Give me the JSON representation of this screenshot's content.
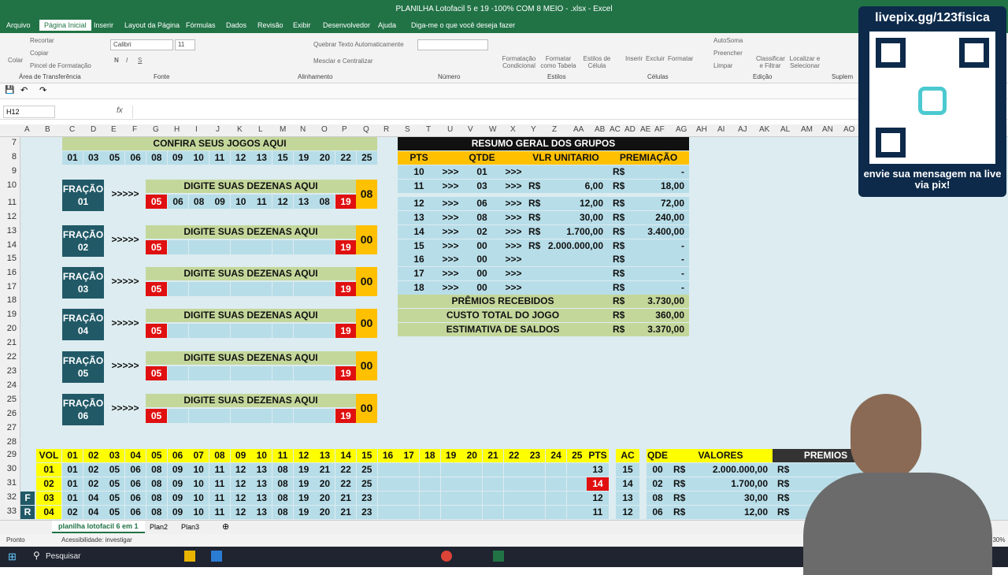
{
  "window": {
    "title": "PLANILHA Lotofacil 5 e 19 -100% COM 8 MEIO - .xlsx  -  Excel"
  },
  "tabs": [
    "Arquivo",
    "Página Inicial",
    "Inserir",
    "Layout da Página",
    "Fórmulas",
    "Dados",
    "Revisão",
    "Exibir",
    "Desenvolvedor",
    "Ajuda",
    "Diga-me o que você deseja fazer"
  ],
  "ribbon": {
    "clipboard": "Área de Transferência",
    "recortar": "Recortar",
    "copiar": "Copiar",
    "pincel": "Pincel de Formatação",
    "colar": "Colar",
    "font_name": "Calibri",
    "font_size": "11",
    "fonte": "Fonte",
    "quebrar": "Quebrar Texto Automaticamente",
    "mesclar": "Mesclar e Centralizar",
    "alinhamento": "Alinhamento",
    "numero": "Número",
    "estilos": "Estilos",
    "cond": "Formatação Condicional",
    "tabela": "Formatar como Tabela",
    "estcel": "Estilos de Célula",
    "inserir": "Inserir",
    "excluir": "Excluir",
    "formatar": "Formatar",
    "celulas": "Células",
    "autosoma": "AutoSoma",
    "preencher": "Preencher",
    "limpar": "Limpar",
    "classificar": "Classificar e Filtrar",
    "localizar": "Localizar e Selecionar",
    "edicao": "Edição",
    "suplem": "Suplem"
  },
  "namebox": "H12",
  "fx": "fx",
  "columns": [
    "A",
    "B",
    "C",
    "D",
    "E",
    "F",
    "G",
    "H",
    "I",
    "J",
    "K",
    "L",
    "M",
    "N",
    "O",
    "P",
    "Q",
    "R",
    "S",
    "T",
    "U",
    "V",
    "W",
    "X",
    "Y",
    "Z",
    "AA",
    "AB",
    "AC",
    "AD",
    "AE",
    "AF",
    "AG",
    "AH",
    "AI",
    "AJ",
    "AK",
    "AL",
    "AM",
    "AN",
    "AO"
  ],
  "rows": [
    "7",
    "8",
    "9",
    "10",
    "11",
    "12",
    "13",
    "14",
    "15",
    "16",
    "17",
    "18",
    "19",
    "20",
    "21",
    "22",
    "23",
    "24",
    "25",
    "26",
    "27",
    "28",
    "29",
    "30",
    "31",
    "32",
    "33"
  ],
  "confira": "CONFIRA SEUS JOGOS AQUI",
  "confira_nums": [
    "01",
    "03",
    "05",
    "06",
    "08",
    "09",
    "10",
    "11",
    "12",
    "13",
    "15",
    "19",
    "20",
    "22",
    "25"
  ],
  "fracoes": [
    {
      "label": "FRAÇÃO",
      "num": "01",
      "arrow": ">>>>>",
      "header": "DIGITE SUAS DEZENAS AQUI",
      "first": "05",
      "mid": [
        "06",
        "08",
        "09",
        "10",
        "11",
        "12",
        "13",
        "08"
      ],
      "last": "19",
      "score": "08"
    },
    {
      "label": "FRAÇÃO",
      "num": "02",
      "arrow": ">>>>>",
      "header": "DIGITE SUAS DEZENAS AQUI",
      "first": "05",
      "mid": [],
      "last": "19",
      "score": "00"
    },
    {
      "label": "FRAÇÃO",
      "num": "03",
      "arrow": ">>>>>",
      "header": "DIGITE SUAS DEZENAS AQUI",
      "first": "05",
      "mid": [],
      "last": "19",
      "score": "00"
    },
    {
      "label": "FRAÇÃO",
      "num": "04",
      "arrow": ">>>>>",
      "header": "DIGITE SUAS DEZENAS AQUI",
      "first": "05",
      "mid": [],
      "last": "19",
      "score": "00"
    },
    {
      "label": "FRAÇÃO",
      "num": "05",
      "arrow": ">>>>>",
      "header": "DIGITE SUAS DEZENAS AQUI",
      "first": "05",
      "mid": [],
      "last": "19",
      "score": "00"
    },
    {
      "label": "FRAÇÃO",
      "num": "06",
      "arrow": ">>>>>",
      "header": "DIGITE SUAS DEZENAS AQUI",
      "first": "05",
      "mid": [],
      "last": "19",
      "score": "00"
    }
  ],
  "resumo": {
    "title": "RESUMO GERAL DOS GRUPOS",
    "h_pts": "PTS",
    "h_qtde": "QTDE",
    "h_vlr": "VLR UNITARIO",
    "h_prem": "PREMIAÇÃO",
    "rows": [
      [
        "10",
        ">>>",
        "01",
        ">>>",
        "",
        "",
        "R$",
        "-"
      ],
      [
        "11",
        ">>>",
        "03",
        ">>>",
        "R$",
        "6,00",
        "R$",
        "18,00"
      ],
      [
        "12",
        ">>>",
        "06",
        ">>>",
        "R$",
        "12,00",
        "R$",
        "72,00"
      ],
      [
        "13",
        ">>>",
        "08",
        ">>>",
        "R$",
        "30,00",
        "R$",
        "240,00"
      ],
      [
        "14",
        ">>>",
        "02",
        ">>>",
        "R$",
        "1.700,00",
        "R$",
        "3.400,00"
      ],
      [
        "15",
        ">>>",
        "00",
        ">>>",
        "R$",
        "2.000.000,00",
        "R$",
        "-"
      ],
      [
        "16",
        ">>>",
        "00",
        ">>>",
        "",
        "",
        "R$",
        "-"
      ],
      [
        "17",
        ">>>",
        "00",
        ">>>",
        "",
        "",
        "R$",
        "-"
      ],
      [
        "18",
        ">>>",
        "00",
        ">>>",
        "",
        "",
        "R$",
        "-"
      ]
    ],
    "premios_label": "PRÊMIOS RECEBIDOS",
    "premios_val": "3.730,00",
    "custo_label": "CUSTO TOTAL DO JOGO",
    "custo_val": "360,00",
    "saldo_label": "ESTIMATIVA DE SALDOS",
    "saldo_val": "3.370,00",
    "rs": "R$"
  },
  "bottom": {
    "vol": "VOL",
    "nums": [
      "01",
      "02",
      "03",
      "04",
      "05",
      "06",
      "07",
      "08",
      "09",
      "10",
      "11",
      "12",
      "13",
      "14",
      "15",
      "16",
      "17",
      "18",
      "19",
      "20",
      "21",
      "22",
      "23",
      "24",
      "25"
    ],
    "pts": "PTS",
    "ac": "AC",
    "qde": "QDE",
    "valores": "VALORES",
    "premios": "PREMIOS",
    "rows": [
      {
        "side": "",
        "vol": "01",
        "vals": [
          "01",
          "02",
          "05",
          "06",
          "08",
          "09",
          "10",
          "11",
          "12",
          "13",
          "08",
          "19",
          "21",
          "22",
          "25"
        ],
        "pts": "13",
        "ac": "15",
        "qde": "00",
        "rs": "R$",
        "val": "2.000.000,00",
        "rs2": "R$"
      },
      {
        "side": "",
        "vol": "02",
        "vals": [
          "01",
          "02",
          "05",
          "06",
          "08",
          "09",
          "10",
          "11",
          "12",
          "13",
          "08",
          "19",
          "20",
          "22",
          "25"
        ],
        "pts": "14",
        "ac": "14",
        "qde": "02",
        "rs": "R$",
        "val": "1.700,00",
        "rs2": "R$"
      },
      {
        "side": "F",
        "vol": "03",
        "vals": [
          "01",
          "04",
          "05",
          "06",
          "08",
          "09",
          "10",
          "11",
          "12",
          "13",
          "08",
          "19",
          "20",
          "21",
          "23"
        ],
        "pts": "12",
        "ac": "13",
        "qde": "08",
        "rs": "R$",
        "val": "30,00",
        "rs2": "R$"
      },
      {
        "side": "R",
        "vol": "04",
        "vals": [
          "02",
          "04",
          "05",
          "06",
          "08",
          "09",
          "10",
          "11",
          "12",
          "13",
          "08",
          "19",
          "20",
          "21",
          "23"
        ],
        "pts": "11",
        "ac": "12",
        "qde": "06",
        "rs": "R$",
        "val": "12,00",
        "rs2": "R$"
      }
    ]
  },
  "sheets": [
    "planilha lotofacil 6 em 1",
    "Plan2",
    "Plan3"
  ],
  "status": {
    "ready": "Pronto",
    "access": "Acessibilidade: investigar",
    "zoom": "130%"
  },
  "taskbar": {
    "search": "Pesquisar"
  },
  "overlay": {
    "url": "livepix.gg/123fisica",
    "msg": "envie sua mensagem na live via pix!"
  }
}
